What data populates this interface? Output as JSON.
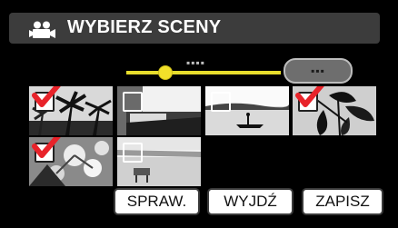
{
  "header": {
    "title": "WYBIERZ SCENY",
    "icon": "video-camera-icon"
  },
  "navigator": {
    "page_indicator": "▪▪▪▪",
    "pill_label": "▪▪▪",
    "slider_position": 0.25,
    "accent_color": "#e7dd2c"
  },
  "thumbnails": [
    {
      "checked": true,
      "scene": "palm-trees"
    },
    {
      "checked": false,
      "scene": "bed-room"
    },
    {
      "checked": false,
      "scene": "lake-boat"
    },
    {
      "checked": true,
      "scene": "leaves"
    },
    {
      "checked": true,
      "scene": "flowers"
    },
    {
      "checked": false,
      "scene": "beach"
    }
  ],
  "buttons": {
    "check": "SPRAW.",
    "exit": "WYJDŹ",
    "save": "ZAPISZ"
  },
  "colors": {
    "check_mark": "#e8232a",
    "background": "#000000",
    "title_bar": "#3c3c3c"
  }
}
